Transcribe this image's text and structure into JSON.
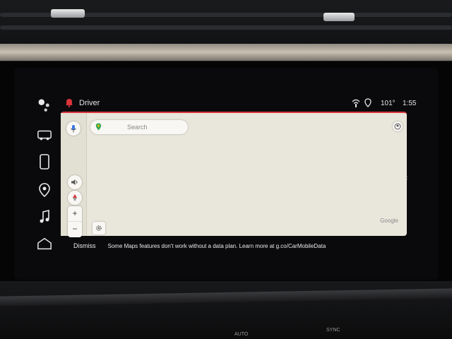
{
  "status_bar": {
    "profile_name": "Driver",
    "temperature": "101°",
    "time": "1:55"
  },
  "map": {
    "search_placeholder": "Search",
    "attribution": "Google",
    "zoom_in": "+",
    "zoom_out": "−"
  },
  "banner": {
    "dismiss_label": "Dismiss",
    "message": "Some Maps features don't work without a data plan. Learn more at g.co/CarMobileData"
  },
  "hvac": {
    "labels": [
      "AUTO",
      "SYNC"
    ]
  },
  "colors": {
    "accent_red": "#d8343a",
    "map_bg": "#e9e6db",
    "screen_bg": "#0a0a0c"
  },
  "icons": {
    "rail": [
      "assistant-dots-icon",
      "vehicle-icon",
      "phone-icon",
      "map-pin-icon",
      "music-note-icon",
      "home-icon"
    ],
    "status": [
      "bell-icon",
      "wifi-icon",
      "location-icon"
    ]
  }
}
